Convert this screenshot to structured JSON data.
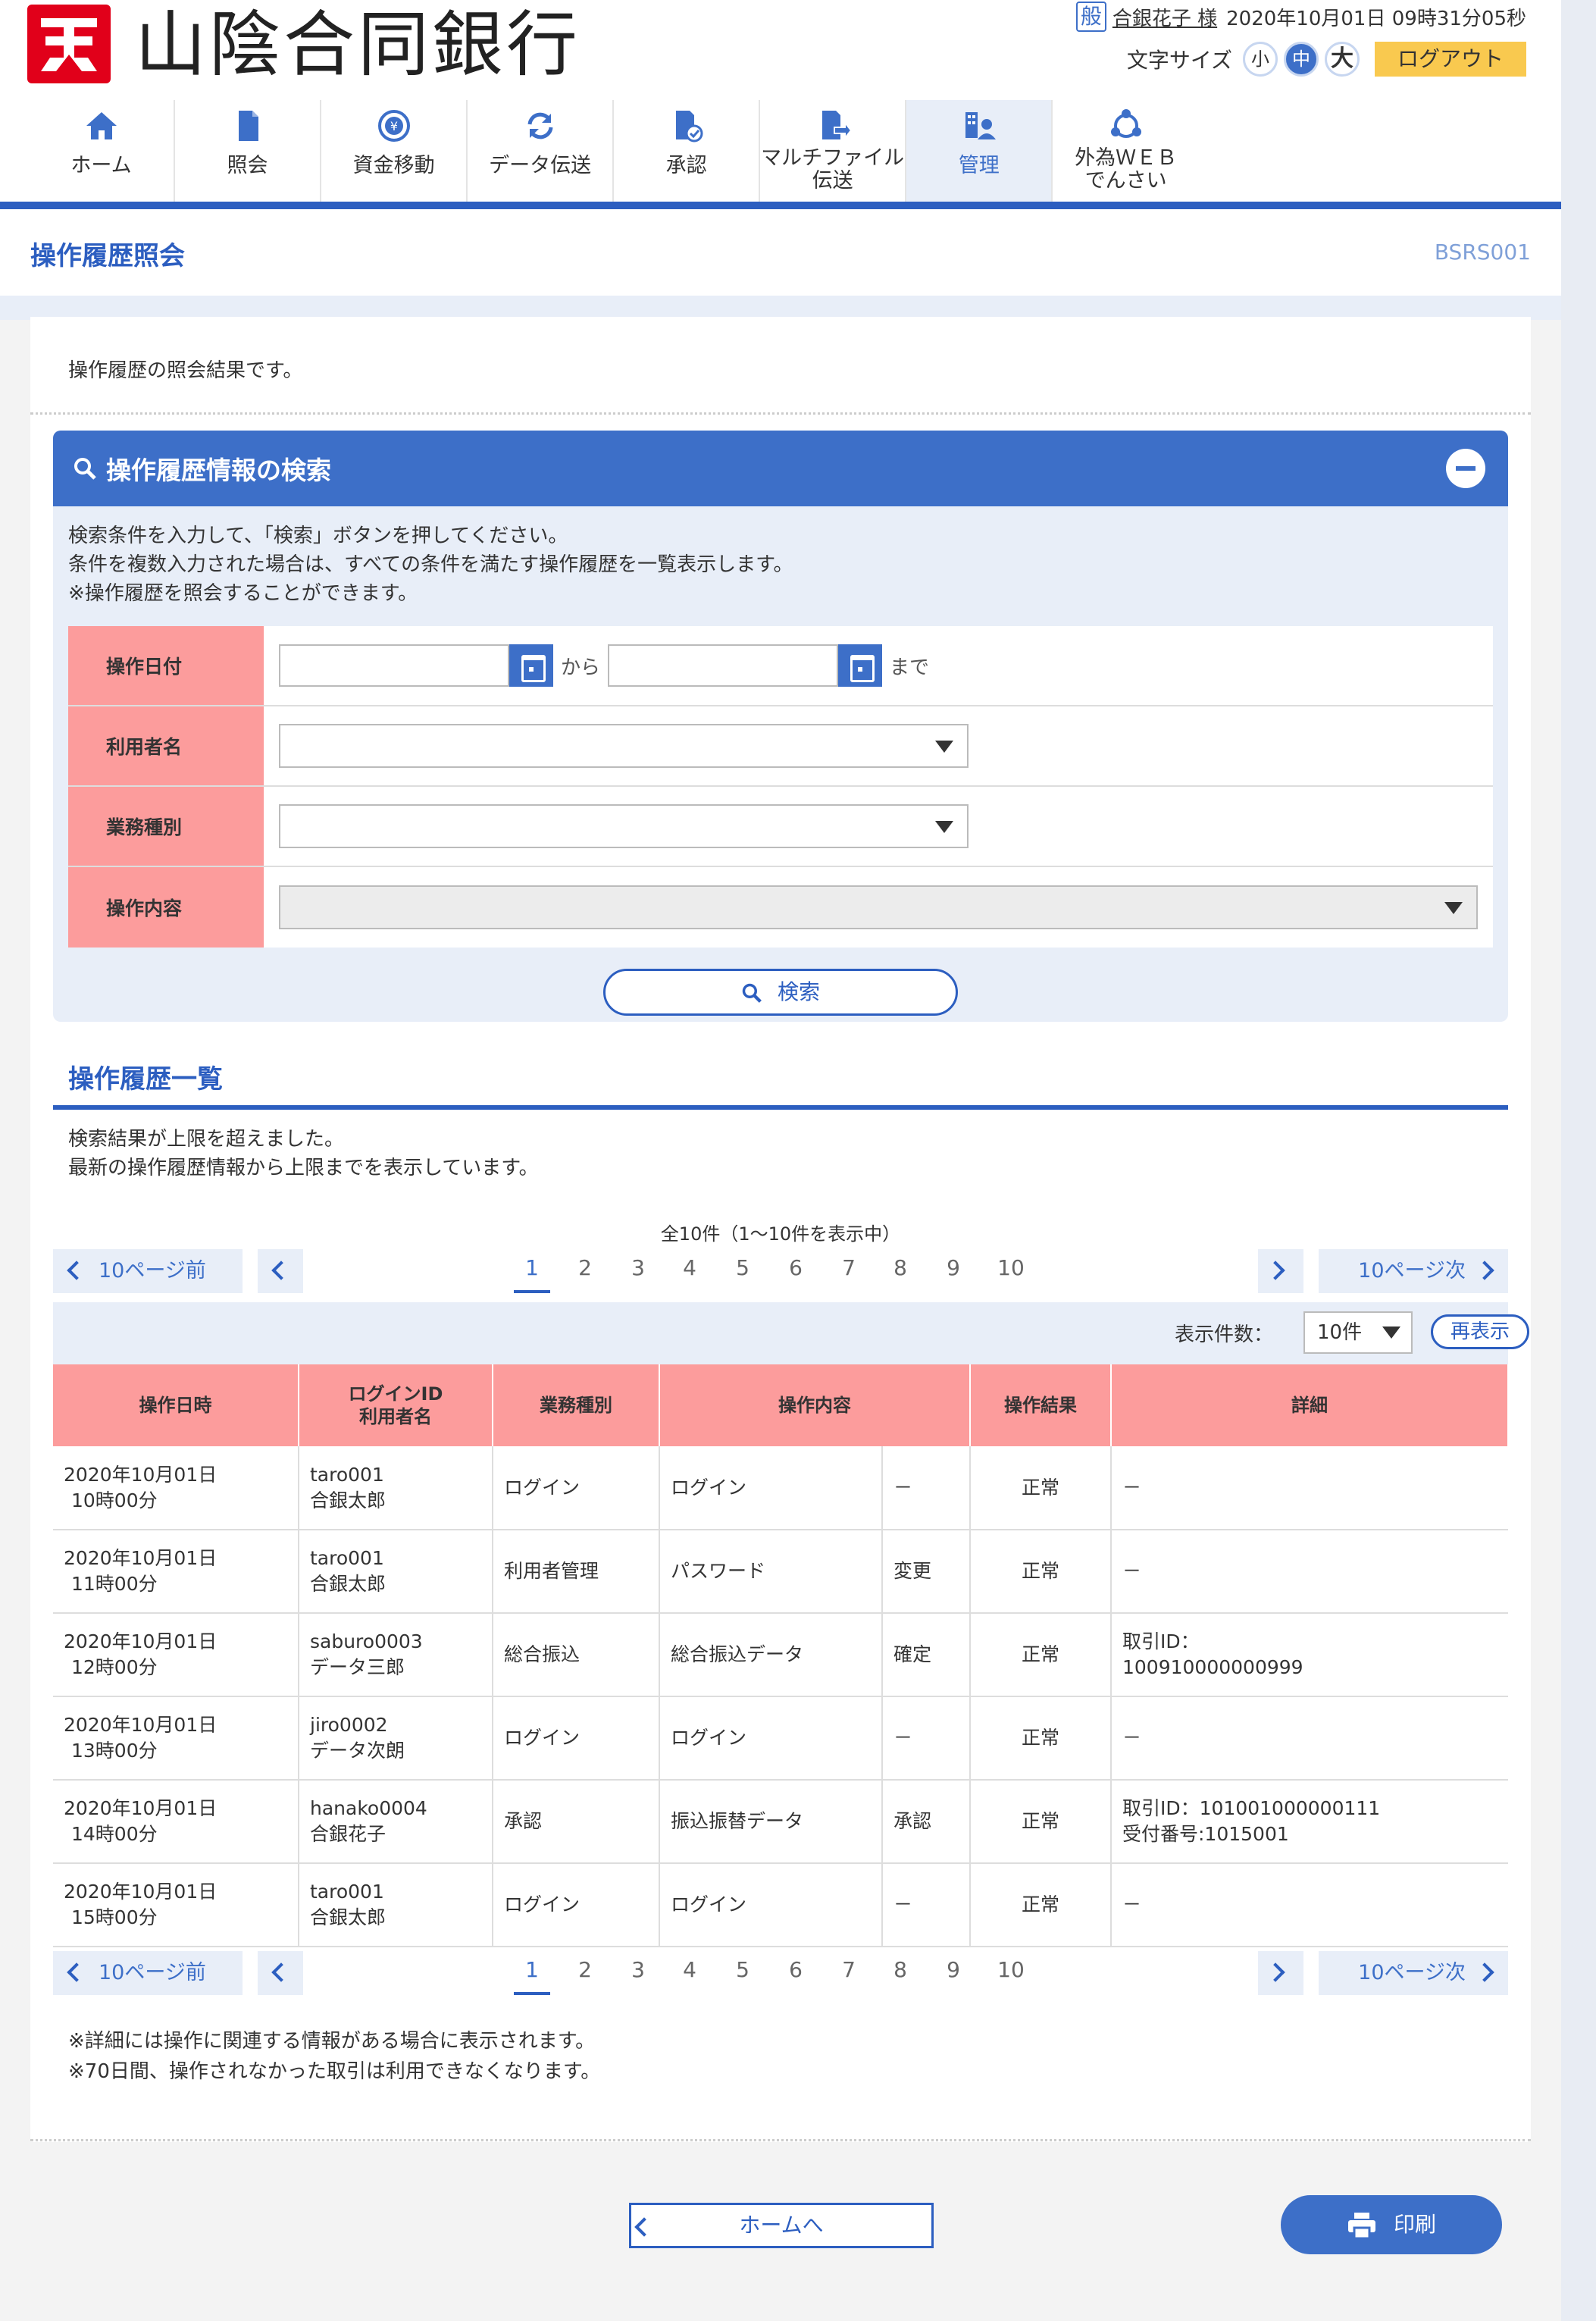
{
  "header": {
    "bank_name": "山陰合同銀行",
    "user_badge": "般",
    "user_name": "合銀花子 様",
    "datetime": "2020年10月01日 09時31分05秒",
    "font_size_label": "文字サイズ",
    "font_small": "小",
    "font_medium": "中",
    "font_large": "大",
    "logout": "ログアウト"
  },
  "nav": [
    {
      "label": "ホーム",
      "icon": "home-icon"
    },
    {
      "label": "照会",
      "icon": "document-icon"
    },
    {
      "label": "資金移動",
      "icon": "yen-transfer-icon"
    },
    {
      "label": "データ伝送",
      "icon": "refresh-icon"
    },
    {
      "label": "承認",
      "icon": "approve-document-icon"
    },
    {
      "label": "マルチファイル伝送",
      "label_l1": "マルチファイル",
      "label_l2": "伝送",
      "icon": "file-send-icon"
    },
    {
      "label": "管理",
      "icon": "management-icon",
      "active": true
    },
    {
      "label": "外為ＷＥＢでんさい",
      "label_l1": "外為ＷＥＢ",
      "label_l2": "でんさい",
      "icon": "network-icon"
    }
  ],
  "page": {
    "title": "操作履歴照会",
    "screen_id": "BSRS001",
    "intro": "操作履歴の照会結果です。"
  },
  "search": {
    "title": "操作履歴情報の検索",
    "desc1": "検索条件を入力して、「検索」ボタンを押してください。",
    "desc2": "条件を複数入力された場合は、すべての条件を満たす操作履歴を一覧表示します。",
    "desc3": "※操作履歴を照会することができます。",
    "date_label": "操作日付",
    "from": "から",
    "to": "まで",
    "user_label": "利用者名",
    "service_label": "業務種別",
    "op_label": "操作内容",
    "button": "検索"
  },
  "list": {
    "title": "操作履歴一覧",
    "msg1": "検索結果が上限を超えました。",
    "msg2": "最新の操作履歴情報から上限までを表示しています。",
    "total": "全10件（1〜10件を表示中）",
    "prev10": "10ページ前",
    "next10": "10ページ次",
    "pages": [
      "1",
      "2",
      "3",
      "4",
      "5",
      "6",
      "7",
      "8",
      "9",
      "10"
    ],
    "current_page": "1",
    "count_label": "表示件数：",
    "count_value": "10件",
    "redisplay": "再表示",
    "headers": {
      "datetime": "操作日時",
      "login_l1": "ログインID",
      "login_l2": "利用者名",
      "service": "業務種別",
      "operation": "操作内容",
      "result": "操作結果",
      "detail": "詳細"
    },
    "rows": [
      {
        "date": "2020年10月01日",
        "time": "10時00分",
        "id": "taro001",
        "name": "合銀太郎",
        "service": "ログイン",
        "op1": "ログイン",
        "op2": "－",
        "result": "正常",
        "d1": "－",
        "d2": ""
      },
      {
        "date": "2020年10月01日",
        "time": "11時00分",
        "id": "taro001",
        "name": "合銀太郎",
        "service": "利用者管理",
        "op1": "パスワード",
        "op2": "変更",
        "result": "正常",
        "d1": "－",
        "d2": ""
      },
      {
        "date": "2020年10月01日",
        "time": "12時00分",
        "id": "saburo0003",
        "name": "データ三郎",
        "service": "総合振込",
        "op1": "総合振込データ",
        "op2": "確定",
        "result": "正常",
        "d1": "取引ID：",
        "d2": "100910000000999"
      },
      {
        "date": "2020年10月01日",
        "time": "13時00分",
        "id": "jiro0002",
        "name": "データ次朗",
        "service": "ログイン",
        "op1": "ログイン",
        "op2": "－",
        "result": "正常",
        "d1": "－",
        "d2": ""
      },
      {
        "date": "2020年10月01日",
        "time": "14時00分",
        "id": "hanako0004",
        "name": "合銀花子",
        "service": "承認",
        "op1": "振込振替データ",
        "op2": "承認",
        "result": "正常",
        "d1": "取引ID：101001000000111",
        "d2": "受付番号:1015001"
      },
      {
        "date": "2020年10月01日",
        "time": "15時00分",
        "id": "taro001",
        "name": "合銀太郎",
        "service": "ログイン",
        "op1": "ログイン",
        "op2": "－",
        "result": "正常",
        "d1": "－",
        "d2": ""
      }
    ],
    "note1": "※詳細には操作に関連する情報がある場合に表示されます。",
    "note2": "※70日間、操作されなかった取引は利用できなくなります。"
  },
  "footer": {
    "home": "ホームへ",
    "print": "印刷"
  },
  "colors": {
    "primary": "#3d6fc8",
    "dark_primary": "#2c5ec0",
    "label_pink": "#fc9c9c",
    "panel_bg": "#e8eef8",
    "logout_yellow": "#f9c94f",
    "logo_red": "#e1001a"
  }
}
